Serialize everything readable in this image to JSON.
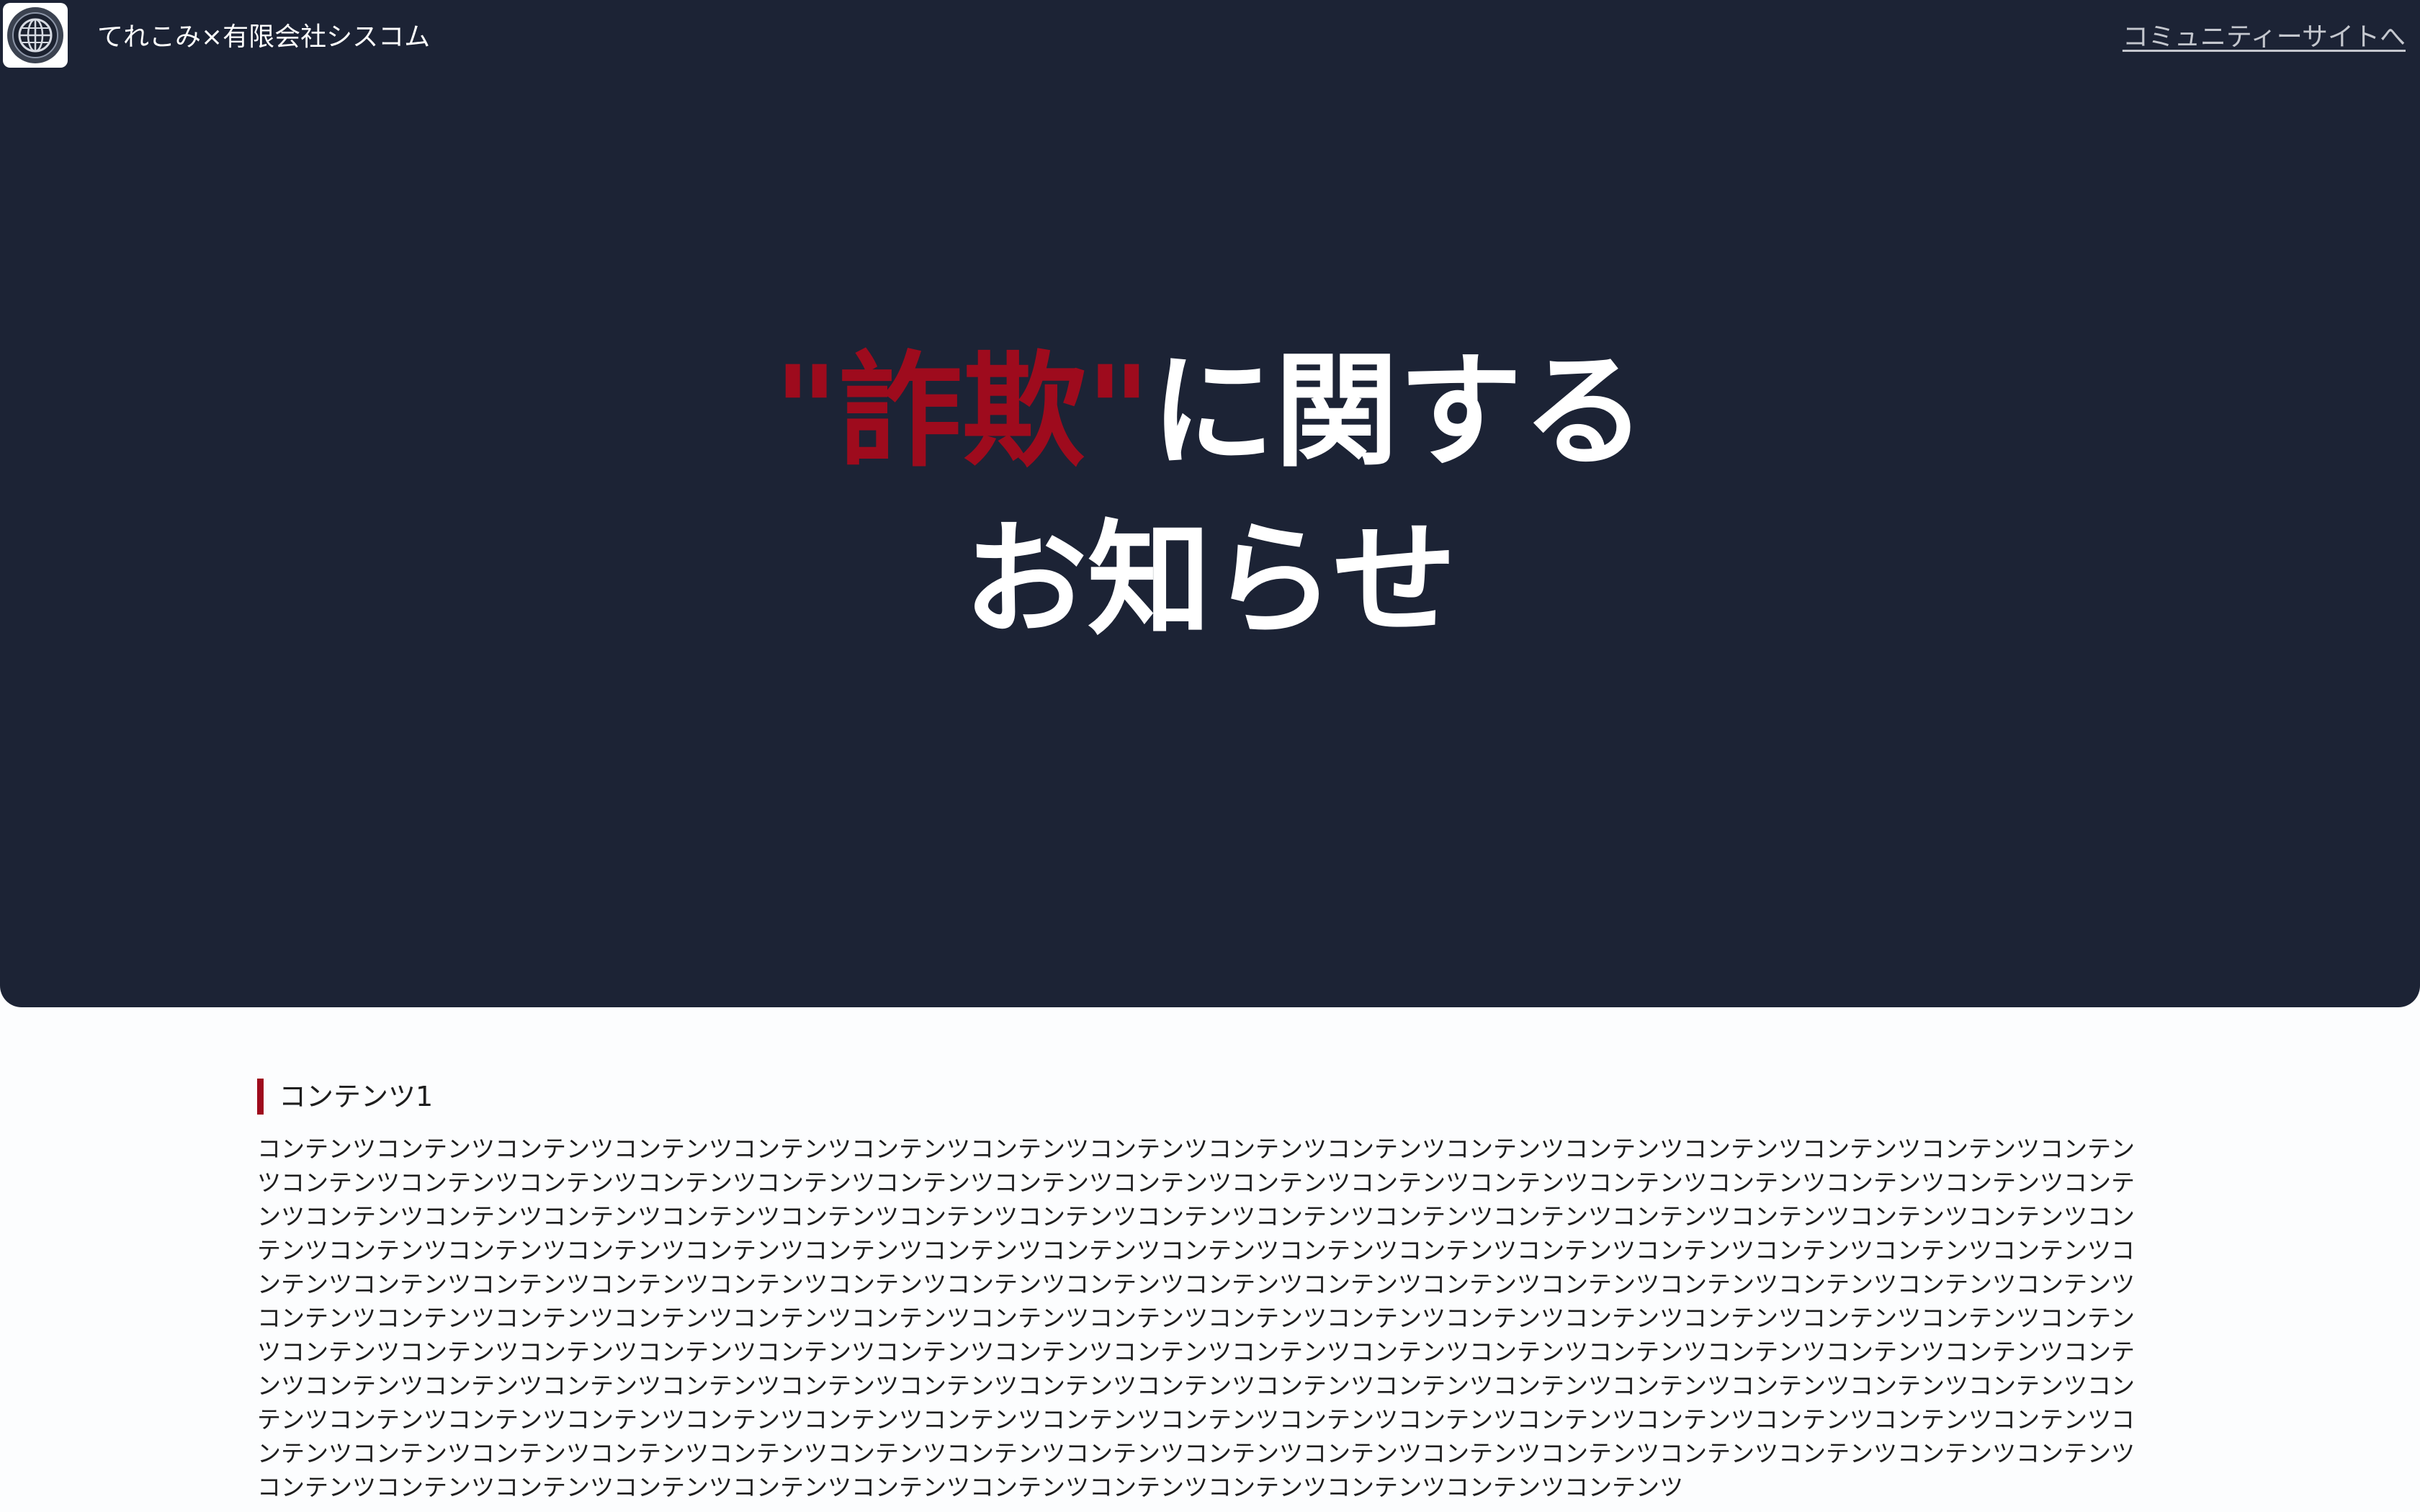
{
  "header": {
    "logo_icon": "globe-emblem-icon",
    "site_title": "てれこみ×有限会社シスコム",
    "community_link": "コミュニティーサイトへ"
  },
  "hero": {
    "headline_accent": "\"詐欺\"",
    "headline_rest": "に関する",
    "headline_line2": "お知らせ",
    "accent_color": "#9e0b1d",
    "background_color": "#1c2335"
  },
  "sections": [
    {
      "title": "コンテンツ1",
      "body": "コンテンツコンテンツコンテンツコンテンツコンテンツコンテンツコンテンツコンテンツコンテンツコンテンツコンテンツコンテンツコンテンツコンテンツコンテンツコンテンツコンテンツコンテンツコンテンツコンテンツコンテンツコンテンツコンテンツコンテンツコンテンツコンテンツコンテンツコンテンツコンテンツコンテンツコンテンツコンテンツコンテンツコンテンツコンテンツコンテンツコンテンツコンテンツコンテンツコンテンツコンテンツコンテンツコンテンツコンテンツコンテンツコンテンツコンテンツコンテンツコンテンツコンテンツコンテンツコンテンツコンテンツコンテンツコンテンツコンテンツコンテンツコンテンツコンテンツコンテンツコンテンツコンテンツコンテンツコンテンツコンテンツコンテンツコンテンツコンテンツコンテンツコンテンツコンテンツコンテンツコンテンツコンテンツコンテンツコンテンツコンテンツコンテンツコンテンツコンテンツコンテンツコンテンツコンテンツコンテンツコンテンツコンテンツコンテンツコンテンツコンテンツコンテンツコンテンツコンテンツコンテンツコンテンツコンテンツコンテンツコンテンツコンテンツコンテンツコンテンツコンテンツコンテンツコンテンツコンテンツコンテンツコンテンツコンテンツコンテンツコンテンツコンテンツコンテンツコンテンツコンテンツコンテンツコンテンツコンテンツコンテンツコンテンツコンテンツコンテンツコンテンツコンテンツコンテンツコンテンツコンテンツコンテンツコンテンツコンテンツコンテンツコンテンツコンテンツコンテンツコンテンツコンテンツコンテンツコンテンツコンテンツコンテンツコンテンツコンテンツコンテンツコンテンツコンテンツコンテンツコンテンツコンテンツコンテンツコンテンツコンテンツコンテンツコンテンツコンテンツコンテンツコンテンツコンテンツコンテンツコンテンツコンテンツコンテンツコンテンツコンテンツコンテンツコンテンツコンテンツコンテンツコンテンツコンテンツコンテンツコンテンツコンテンツ"
    }
  ]
}
